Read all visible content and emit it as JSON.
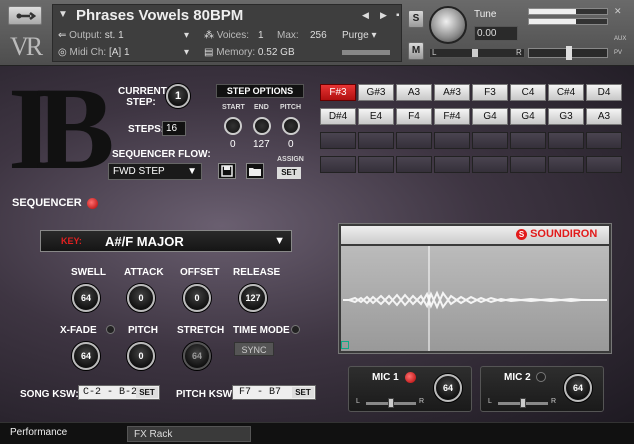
{
  "header": {
    "instrument_name": "Phrases Vowels 80BPM",
    "output_label": "Output:",
    "output_value": "st. 1",
    "voices_label": "Voices:",
    "voices_value": "1",
    "max_label": "Max:",
    "max_value": "256",
    "purge_label": "Purge",
    "midi_label": "Midi Ch:",
    "midi_value": "[A]  1",
    "memory_label": "Memory:",
    "memory_value": "0.52 GB",
    "s_label": "S",
    "m_label": "M",
    "tune_label": "Tune",
    "tune_value": "0.00",
    "aux_label": "AUX",
    "pv_label": "PV",
    "pan_left": "L",
    "pan_right": "R"
  },
  "sequencer": {
    "current_step_label": "CURRENT STEP:",
    "current_step_value": "1",
    "steps_label": "STEPS:",
    "steps_value": "16",
    "flow_label": "SEQUENCER FLOW:",
    "flow_value": "FWD STEP",
    "step_options_label": "STEP OPTIONS",
    "start_label": "START",
    "end_label": "END",
    "pitch_label": "PITCH",
    "start_value": "0",
    "end_value": "127",
    "pitch_value": "0",
    "assign_label": "ASSIGN",
    "set_label": "SET",
    "section_label": "SEQUENCER",
    "steps_row1": [
      "F#3",
      "G#3",
      "A3",
      "A#3",
      "F3",
      "C4",
      "C#4",
      "D4"
    ],
    "steps_row2": [
      "D#4",
      "E4",
      "F4",
      "F#4",
      "G4",
      "G4",
      "G3",
      "A3"
    ]
  },
  "controls": {
    "key_label": "KEY:",
    "key_value": "A#/F MAJOR",
    "swell_label": "SWELL",
    "swell_value": "64",
    "attack_label": "ATTACK",
    "attack_value": "0",
    "offset_label": "OFFSET",
    "offset_value": "0",
    "release_label": "RELEASE",
    "release_value": "127",
    "xfade_label": "X-FADE",
    "xfade_value": "64",
    "pitch_label": "PITCH",
    "pitch_value": "0",
    "stretch_label": "STRETCH",
    "stretch_value": "64",
    "time_mode_label": "TIME MODE",
    "sync_label": "SYNC",
    "song_ksw_label": "SONG KSW:",
    "song_ksw_value": "C-2 - B-2",
    "pitch_ksw_label": "PITCH KSW:",
    "pitch_ksw_value": "F7 - B7",
    "set_label": "SET"
  },
  "waveform": {
    "brand": "SOUNDIRON"
  },
  "mics": {
    "mic1_label": "MIC 1",
    "mic1_value": "64",
    "mic2_label": "MIC 2",
    "mic2_value": "64",
    "l": "L",
    "r": "R"
  },
  "footer": {
    "tab1": "Performance",
    "tab2": "FX Rack"
  },
  "colors": {
    "active_step": "#e02020",
    "brand_red": "#e21a1a"
  }
}
